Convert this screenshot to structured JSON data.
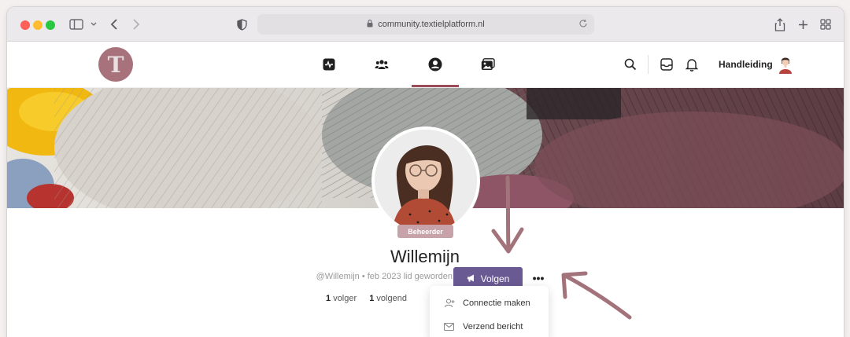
{
  "browser": {
    "url": "community.textielplatform.nl"
  },
  "site": {
    "logo_letter": "T",
    "nav": [
      {
        "name": "activity",
        "icon": "activity-icon"
      },
      {
        "name": "members",
        "icon": "group-icon"
      },
      {
        "name": "profile",
        "icon": "user-circle-icon",
        "active": true
      },
      {
        "name": "gallery",
        "icon": "photos-icon"
      }
    ],
    "handleiding_label": "Handleiding"
  },
  "profile": {
    "role": "Beheerder",
    "name": "Willemijn",
    "meta": "@Willemijn • feb 2023 lid geworden",
    "follow_label": "Volgen",
    "more_label": "•••",
    "followers_count": "1",
    "followers_label": "volger",
    "following_count": "1",
    "following_label": "volgend"
  },
  "dropdown": {
    "items": [
      {
        "label": "Connectie maken",
        "icon": "add-user-icon"
      },
      {
        "label": "Verzend bericht",
        "icon": "mail-icon"
      }
    ]
  },
  "colors": {
    "accent": "#9c4c59",
    "button": "#6a5a93",
    "badge": "#c7a2a8",
    "logo": "#a7727b"
  }
}
